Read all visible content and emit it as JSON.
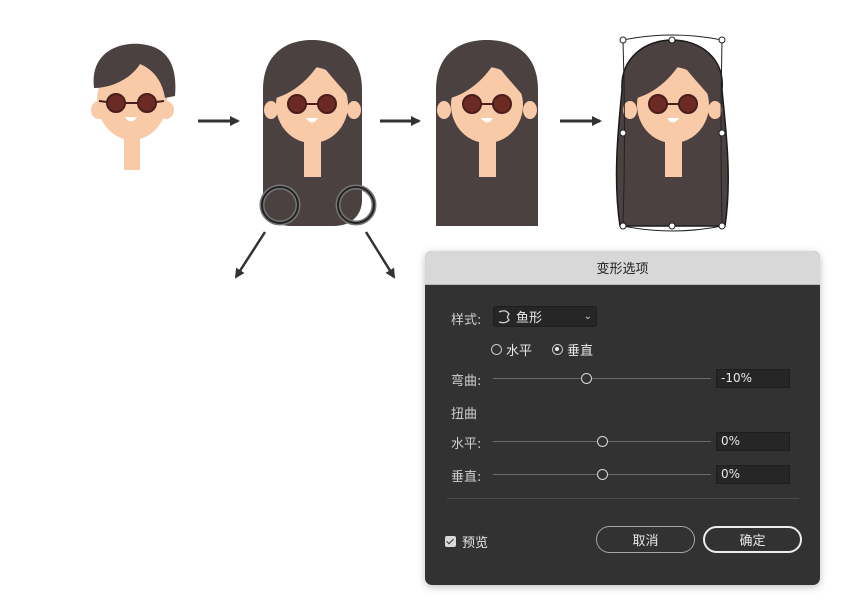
{
  "dialog": {
    "title": "变形选项",
    "style_label": "样式:",
    "style_value": "鱼形",
    "style_icon": "arch-shape-icon",
    "orientation": {
      "horizontal_label": "水平",
      "vertical_label": "垂直",
      "selected": "vertical"
    },
    "bend": {
      "label": "弯曲:",
      "value": "-10%",
      "fraction": 0.43
    },
    "distortion_heading": "扭曲",
    "horizontal_distortion": {
      "label": "水平:",
      "value": "0%",
      "fraction": 0.5
    },
    "vertical_distortion": {
      "label": "垂直:",
      "value": "0%",
      "fraction": 0.5
    },
    "preview_label": "预览",
    "preview_checked": true,
    "cancel_label": "取消",
    "ok_label": "确定"
  },
  "colors": {
    "hair": "#4b4140",
    "skin": "#f8caa8",
    "glasses": "#6b2b24",
    "dialog_bg": "#333232",
    "titlebar_bg": "#d8d8d8",
    "arrow": "#333333",
    "cheek": "#f3b291"
  }
}
